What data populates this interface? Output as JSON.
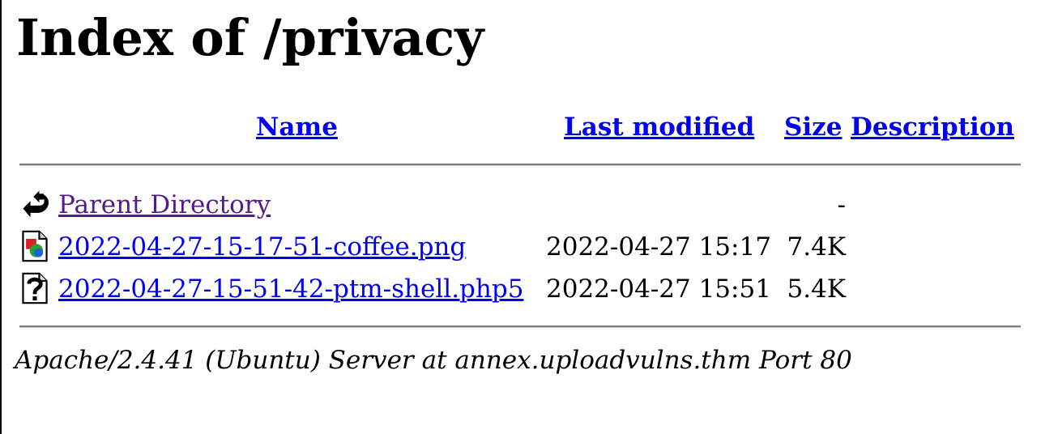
{
  "page": {
    "title": "Index of /privacy"
  },
  "table": {
    "headers": {
      "name": "Name",
      "last_modified": "Last modified",
      "size": "Size",
      "description": "Description"
    },
    "rows": [
      {
        "name": "Parent Directory",
        "date": "",
        "size": "-",
        "icon": "back-arrow-icon"
      },
      {
        "name": "2022-04-27-15-17-51-coffee.png",
        "date": "2022-04-27 15:17",
        "size": "7.4K",
        "icon": "image-file-icon"
      },
      {
        "name": "2022-04-27-15-51-42-ptm-shell.php5",
        "date": "2022-04-27 15:51",
        "size": "5.4K",
        "icon": "unknown-file-icon"
      }
    ]
  },
  "footer": {
    "address": "Apache/2.4.41 (Ubuntu) Server at annex.uploadvulns.thm Port 80"
  },
  "colors": {
    "link": "#0000ee",
    "visited_link": "#551a8b",
    "rule": "#7a7a7a"
  }
}
